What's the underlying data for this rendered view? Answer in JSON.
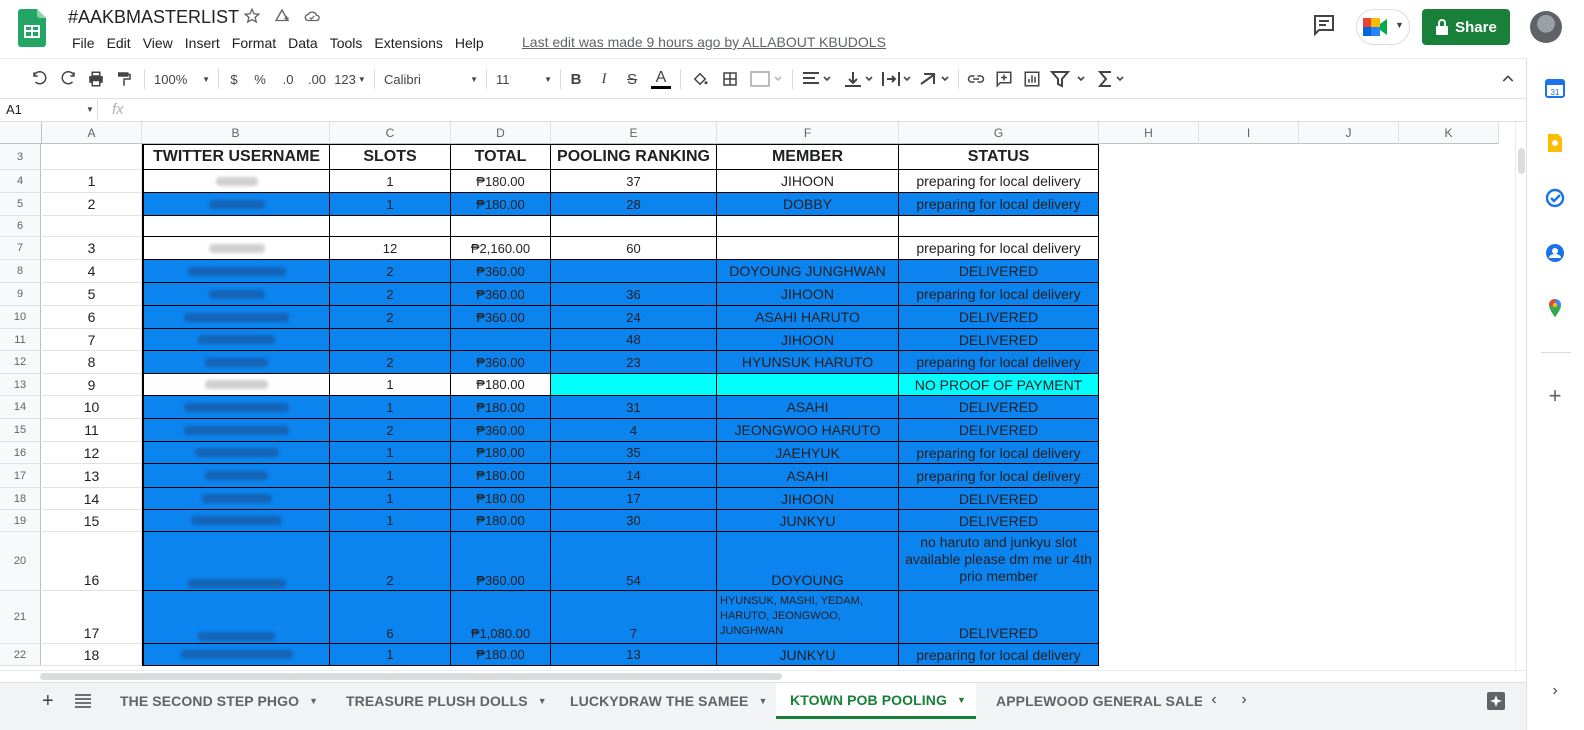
{
  "header": {
    "doc_title": "#AAKBMASTERLIST",
    "menu": [
      "File",
      "Edit",
      "View",
      "Insert",
      "Format",
      "Data",
      "Tools",
      "Extensions",
      "Help"
    ],
    "last_edit": "Last edit was made 9 hours ago by ALLABOUT KBUDOLS",
    "share_label": "Share"
  },
  "toolbar": {
    "zoom": "100%",
    "currency": "$",
    "percent": "%",
    "dec_decrease": ".0",
    "dec_increase": ".00",
    "format_more": "123",
    "font": "Calibri",
    "font_size": "11",
    "bold": "B",
    "italic": "I",
    "strike": "S",
    "text_color": "A"
  },
  "formula_bar": {
    "cell_ref": "A1",
    "fx": "fx"
  },
  "columns": [
    "A",
    "B",
    "C",
    "D",
    "E",
    "F",
    "G",
    "H",
    "I",
    "J",
    "K"
  ],
  "header_row": {
    "row_num": "3",
    "cells": [
      "",
      "TWITTER USERNAME",
      "SLOTS",
      "TOTAL",
      "POOLING RANKING",
      "MEMBER",
      "STATUS"
    ]
  },
  "rows": [
    {
      "row_num": "4",
      "fill": "white",
      "no": "1",
      "user": "kjboys",
      "slots": "1",
      "total": "₱180.00",
      "rank": "37",
      "member": "JIHOON",
      "status": "preparing for local delivery"
    },
    {
      "row_num": "5",
      "fill": "blue",
      "no": "2",
      "user": "ahkhaeda",
      "slots": "1",
      "total": "₱180.00",
      "rank": "28",
      "member": "DOBBY",
      "status": "preparing for local delivery"
    },
    {
      "row_num": "6",
      "fill": "white",
      "no": "",
      "user": "",
      "slots": "",
      "total": "",
      "rank": "",
      "member": "",
      "status": ""
    },
    {
      "row_num": "7",
      "fill": "white",
      "no": "3",
      "user": "@xxxkabt",
      "slots": "12",
      "total": "₱2,160.00",
      "rank": "60",
      "member": "",
      "status": "preparing for local delivery"
    },
    {
      "row_num": "8",
      "fill": "blue",
      "no": "4",
      "user": "@rhfxnantacarl",
      "slots": "2",
      "total": "₱360.00",
      "rank": "",
      "member": "DOYOUNG JUNGHWAN",
      "status": "DELIVERED"
    },
    {
      "row_num": "9",
      "fill": "blue",
      "no": "5",
      "user": "travcarl",
      "slots": "2",
      "total": "₱360.00",
      "rank": "36",
      "member": "JIHOON",
      "status": "preparing for local delivery"
    },
    {
      "row_num": "10",
      "fill": "blue",
      "no": "6",
      "user": "happygirltoyink",
      "slots": "2",
      "total": "₱360.00",
      "rank": "24",
      "member": "ASAHI HARUTO",
      "status": "DELIVERED"
    },
    {
      "row_num": "11",
      "fill": "blue",
      "no": "7",
      "user": "@harunambun",
      "slots": "",
      "total": "",
      "rank": "48",
      "member": "JIHOON",
      "status": "DELIVERED"
    },
    {
      "row_num": "12",
      "fill": "blue",
      "no": "8",
      "user": "@taucarl_",
      "slots": "2",
      "total": "₱360.00",
      "rank": "23",
      "member": "HYUNSUK HARUTO",
      "status": "preparing for local delivery"
    },
    {
      "row_num": "13",
      "fill": "cyan",
      "no": "9",
      "user": "aktterlog",
      "slots": "1",
      "total": "₱180.00",
      "rank": "",
      "member": "",
      "status": "NO PROOF OF PAYMENT"
    },
    {
      "row_num": "14",
      "fill": "blue",
      "no": "10",
      "user": "@jaenabutterfly",
      "slots": "1",
      "total": "₱180.00",
      "rank": "31",
      "member": "ASAHI",
      "status": "DELIVERED"
    },
    {
      "row_num": "15",
      "fill": "blue",
      "no": "11",
      "user": "@haruniconsflex",
      "slots": "2",
      "total": "₱360.00",
      "rank": "4",
      "member": "JEONGWOO HARUTO",
      "status": "DELIVERED"
    },
    {
      "row_num": "16",
      "fill": "blue",
      "no": "12",
      "user": "@jaecrossahi",
      "slots": "1",
      "total": "₱180.00",
      "rank": "35",
      "member": "JAEHYUK",
      "status": "preparing for local delivery"
    },
    {
      "row_num": "17",
      "fill": "blue",
      "no": "13",
      "user": "ni_trajle",
      "slots": "1",
      "total": "₱180.00",
      "rank": "14",
      "member": "ASAHI",
      "status": "preparing for local delivery"
    },
    {
      "row_num": "18",
      "fill": "blue",
      "no": "14",
      "user": "@harutanie",
      "slots": "1",
      "total": "₱180.00",
      "rank": "17",
      "member": "JIHOON",
      "status": "DELIVERED"
    },
    {
      "row_num": "19",
      "fill": "blue",
      "no": "15",
      "user": "@sauchnastr07",
      "slots": "1",
      "total": "₱180.00",
      "rank": "30",
      "member": "JUNKYU",
      "status": "DELIVERED"
    },
    {
      "row_num": "20",
      "fill": "blue",
      "no": "16",
      "user": "@doyoungehlili",
      "slots": "2",
      "total": "₱360.00",
      "rank": "54",
      "member": "DOYOUNG",
      "status": "no haruto and junkyu slot available please dm me ur 4th prio member"
    },
    {
      "row_num": "21",
      "fill": "blue",
      "no": "17",
      "user": "@Taeangkyu_",
      "slots": "6",
      "total": "₱1,080.00",
      "rank": "7",
      "member": "HYUNSUK, MASHI, YEDAM, HARUTO, JEONGWOO, JUNGHWAN",
      "status": "DELIVERED"
    },
    {
      "row_num": "22",
      "fill": "blue",
      "no": "18",
      "user": "@bonaltee_jeuheu",
      "slots": "1",
      "total": "₱180.00",
      "rank": "13",
      "member": "JUNKYU",
      "status": "preparing for local delivery"
    }
  ],
  "tabs": [
    {
      "label": "THE SECOND STEP PHGO",
      "active": false
    },
    {
      "label": "TREASURE PLUSH DOLLS",
      "active": false
    },
    {
      "label": "LUCKYDRAW THE SAMEE",
      "active": false
    },
    {
      "label": "KTOWN POB POOLING",
      "active": true
    },
    {
      "label": "APPLEWOOD GENERAL SALE",
      "active": false
    }
  ],
  "colors": {
    "blue_fill": "#0b84ef",
    "cyan_fill": "#00ffff",
    "share_green": "#188038"
  }
}
